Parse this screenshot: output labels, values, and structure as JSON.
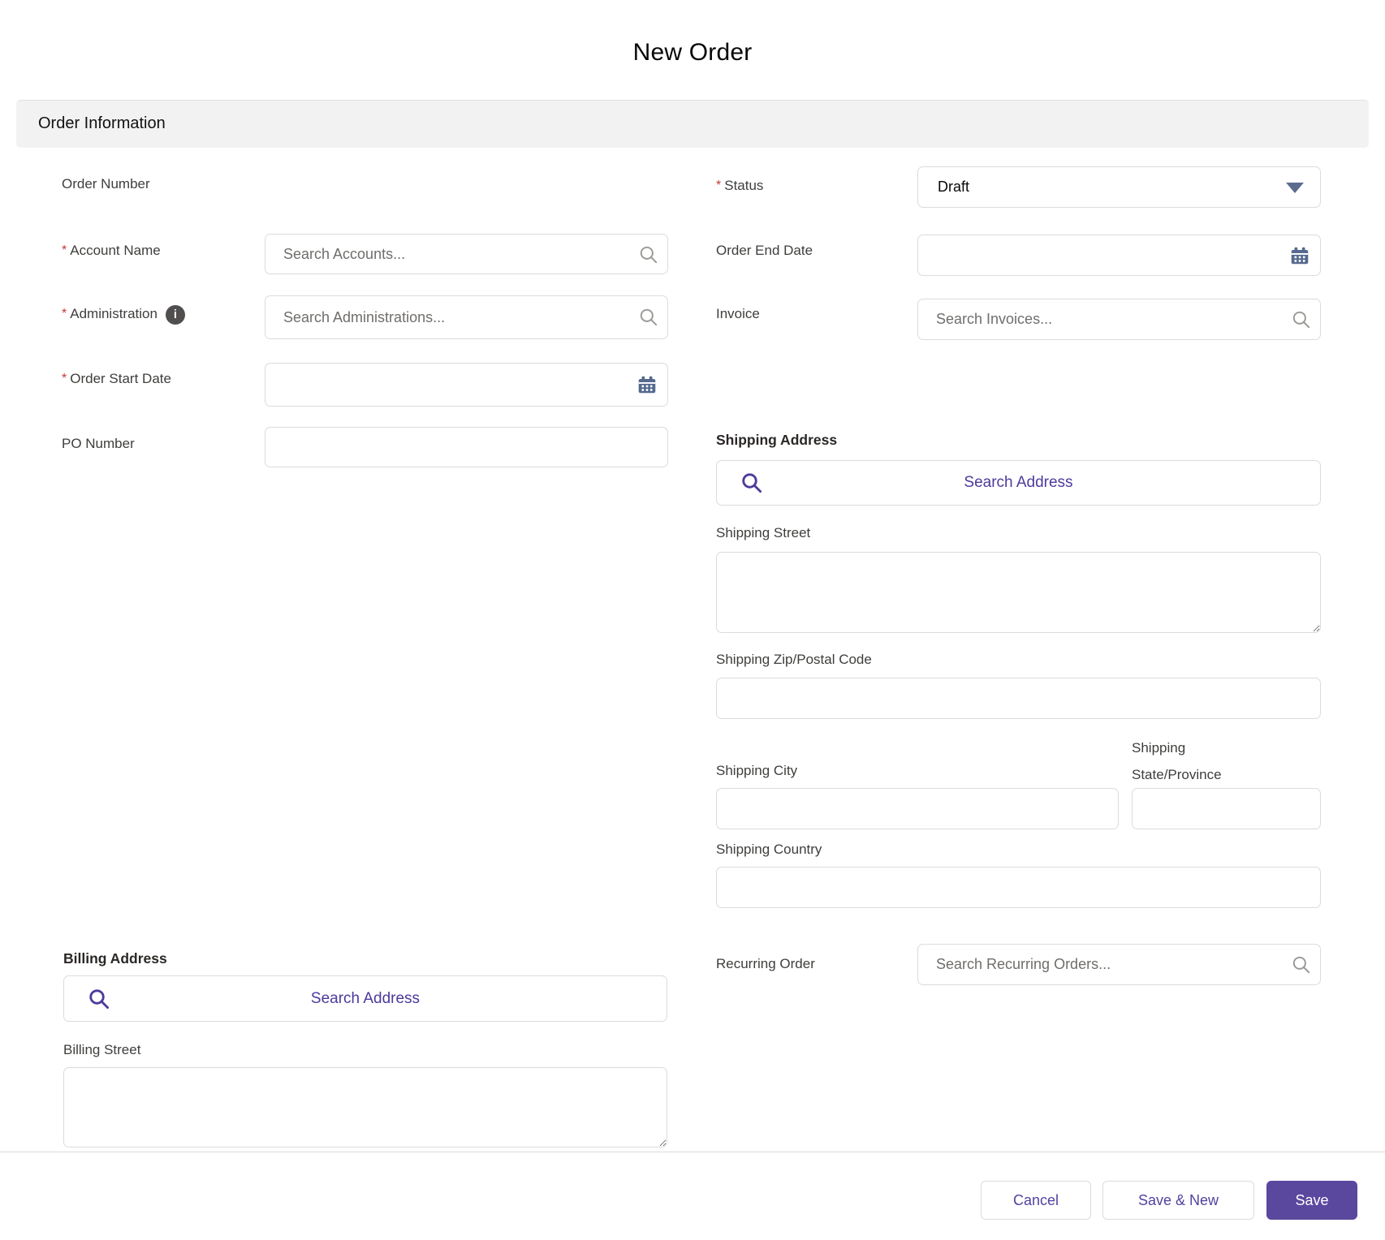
{
  "meta": {
    "required_marker": "*"
  },
  "modal": {
    "title": "New Order",
    "section_title": "Order Information"
  },
  "colors": {
    "accent_purple": "#5a489e",
    "link_purple": "#4e3a9c",
    "required_red": "#c23934",
    "icon_slate": "#54698d",
    "section_bg": "#f3f2f2",
    "border_gray": "#dddbda"
  },
  "fields": {
    "order_number": {
      "label": "Order Number"
    },
    "account_name": {
      "label": "Account Name",
      "placeholder": "Search Accounts..."
    },
    "administration": {
      "label": "Administration",
      "placeholder": "Search Administrations...",
      "info_icon_glyph": "i"
    },
    "order_start_date": {
      "label": "Order Start Date"
    },
    "po_number": {
      "label": "PO Number"
    },
    "status": {
      "label": "Status",
      "value": "Draft"
    },
    "order_end_date": {
      "label": "Order End Date"
    },
    "invoice": {
      "label": "Invoice",
      "placeholder": "Search Invoices..."
    },
    "recurring_order": {
      "label": "Recurring Order",
      "placeholder": "Search Recurring Orders..."
    }
  },
  "shipping": {
    "header": "Shipping Address",
    "search_address_label": "Search Address",
    "street_label": "Shipping Street",
    "zip_label": "Shipping Zip/Postal Code",
    "city_label": "Shipping City",
    "state_label": "Shipping State/Province",
    "country_label": "Shipping Country"
  },
  "billing": {
    "header": "Billing Address",
    "search_address_label": "Search Address",
    "street_label": "Billing Street"
  },
  "footer": {
    "cancel_label": "Cancel",
    "save_new_label": "Save & New",
    "save_label": "Save"
  }
}
